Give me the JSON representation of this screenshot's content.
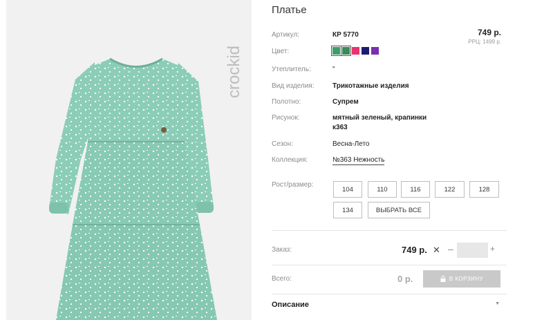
{
  "brand": {
    "logo_text": "crockid"
  },
  "product": {
    "title": "Платье",
    "price": "749 р.",
    "rrp": "РРЦ: 1499 р."
  },
  "attributes": {
    "article_label": "Артикул:",
    "article_value": "КР 5770",
    "color_label": "Цвет:",
    "insulation_label": "Утеплитель:",
    "insulation_value": "\"",
    "type_label": "Вид изделия:",
    "type_value": "Трикотажные изделия",
    "fabric_label": "Полотно:",
    "fabric_value": "Супрем",
    "pattern_label": "Рисунок:",
    "pattern_line1": "мятный зеленый, крапинки",
    "pattern_line2": "к363",
    "season_label": "Сезон:",
    "season_value": "Весна-Лето",
    "collection_label": "Коллекция:",
    "collection_value": "№363 Нежность"
  },
  "colors": [
    {
      "hex": "#3e9e6a",
      "selected": true
    },
    {
      "hex": "#3a8a5a",
      "selected": true
    },
    {
      "hex": "#e8336e",
      "selected": false
    },
    {
      "hex": "#1c1c6e",
      "selected": false
    },
    {
      "hex": "#7a2fb0",
      "selected": false
    }
  ],
  "sizes": {
    "label": "Рост/размер:",
    "options": [
      "104",
      "110",
      "116",
      "122",
      "128",
      "134"
    ],
    "select_all": "ВЫБРАТЬ ВСЕ"
  },
  "order": {
    "label": "Заказ:",
    "price": "749 р.",
    "remove_symbol": "✕",
    "minus": "–",
    "plus": "+",
    "quantity": ""
  },
  "total": {
    "label": "Всего:",
    "value": "0 р.",
    "cart_button": "В КОРЗИНУ"
  },
  "description": {
    "title": "Описание"
  }
}
